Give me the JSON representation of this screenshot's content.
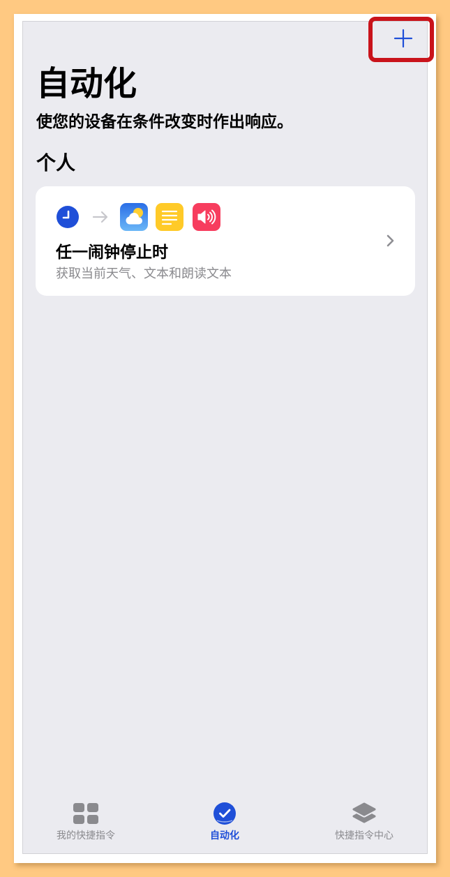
{
  "header": {
    "add_button_icon": "plus-icon"
  },
  "page": {
    "title": "自动化",
    "subtitle": "使您的设备在条件改变时作出响应。"
  },
  "section": {
    "title": "个人"
  },
  "automations": [
    {
      "trigger_icon": "clock-icon",
      "flow_icon": "arrow-right-icon",
      "action_icons": [
        "weather-icon",
        "text-icon",
        "speak-text-icon"
      ],
      "title": "任一闹钟停止时",
      "description": "获取当前天气、文本和朗读文本",
      "disclosure_icon": "chevron-right-icon"
    }
  ],
  "tabbar": {
    "tabs": [
      {
        "label": "我的快捷指令",
        "icon": "grid-icon",
        "active": false
      },
      {
        "label": "自动化",
        "icon": "automation-icon",
        "active": true
      },
      {
        "label": "快捷指令中心",
        "icon": "gallery-icon",
        "active": false
      }
    ]
  },
  "colors": {
    "outer-bg": "#FFC982",
    "screen-bg": "#EBEBF0",
    "card-bg": "#FFFFFF",
    "accent": "#1F4FD8",
    "secondary-text": "#8A8A8E",
    "highlight": "#C9131B",
    "weather-top": "#2A6EE6",
    "weather-bottom": "#6BB7F7",
    "text-app": "#FFCA28",
    "speak-app": "#F73D5E"
  }
}
